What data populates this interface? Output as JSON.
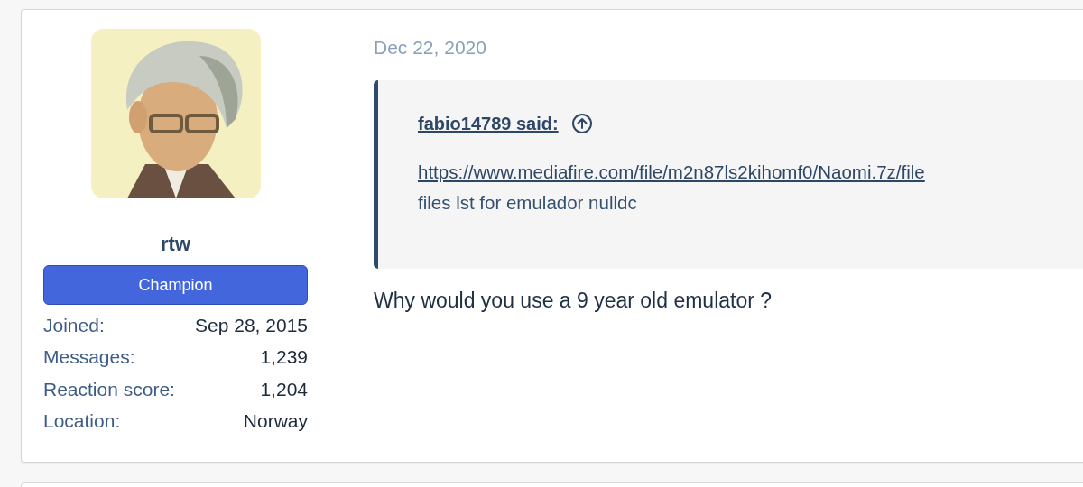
{
  "post": {
    "author": {
      "name": "rtw",
      "badge": "Champion",
      "stats": [
        {
          "label": "Joined:",
          "value": "Sep 28, 2015"
        },
        {
          "label": "Messages:",
          "value": "1,239"
        },
        {
          "label": "Reaction score:",
          "value": "1,204"
        },
        {
          "label": "Location:",
          "value": "Norway"
        }
      ]
    },
    "date": "Dec 22, 2020",
    "quote": {
      "attribution": "fabio14789 said:",
      "link": "https://www.mediafire.com/file/m2n87ls2kihomf0/Naomi.7z/file",
      "text": "files lst for emulador nulldc"
    },
    "message": "Why would you use a 9 year old emulator ?"
  }
}
